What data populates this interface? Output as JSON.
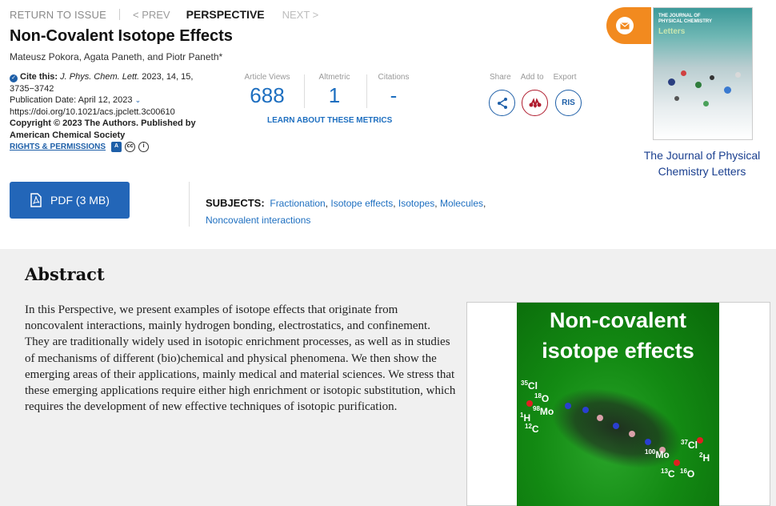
{
  "nav": {
    "return": "RETURN TO ISSUE",
    "prev": "< PREV",
    "current": "PERSPECTIVE",
    "next": "NEXT >"
  },
  "article": {
    "title": "Non-Covalent Isotope Effects",
    "authors": "Mateusz Pokora, Agata Paneth, and Piotr Paneth*",
    "cite_label": "Cite this:",
    "cite_journal": "J. Phys. Chem. Lett.",
    "cite_details": "2023, 14, 15, 3735−3742",
    "pub_date": "Publication Date: April 12, 2023",
    "doi": "https://doi.org/10.1021/acs.jpclett.3c00610",
    "copyright": "Copyright © 2023 The Authors. Published by American Chemical Society",
    "rights": "RIGHTS & PERMISSIONS"
  },
  "metrics": {
    "views_label": "Article Views",
    "views": "688",
    "altmetric_label": "Altmetric",
    "altmetric": "1",
    "citations_label": "Citations",
    "citations": "-",
    "learn": "LEARN ABOUT THESE METRICS"
  },
  "actions": {
    "share": "Share",
    "add_to": "Add to",
    "export": "Export",
    "ris": "RIS"
  },
  "journal": {
    "name": "The Journal of Physical Chemistry Letters",
    "cover_title_1": "THE JOURNAL OF",
    "cover_title_2": "PHYSICAL CHEMISTRY",
    "cover_title_3": "Letters"
  },
  "pdf": {
    "label": "PDF (3 MB)"
  },
  "subjects": {
    "heading": "SUBJECTS:",
    "items": [
      "Fractionation",
      "Isotope effects",
      "Isotopes",
      "Molecules",
      "Noncovalent interactions"
    ]
  },
  "abstract": {
    "heading": "Abstract",
    "text": "In this Perspective, we present examples of isotope effects that originate from noncovalent interactions, mainly hydrogen bonding, electrostatics, and confinement. They are traditionally widely used in isotopic enrichment processes, as well as in studies of mechanisms of different (bio)chemical and physical phenomena. We then show the emerging areas of their applications, mainly medical and material sciences. We stress that these emerging applications require either high enrichment or isotopic substitution, which requires the development of new effective techniques of isotopic purification."
  },
  "toc_graphic": {
    "line1": "Non-covalent",
    "line2": "isotope effects",
    "labels": [
      "35Cl",
      "18O",
      "98Mo",
      "1H",
      "12C",
      "100Mo",
      "37Cl",
      "2H",
      "13C",
      "16O"
    ]
  },
  "colors": {
    "accent": "#1e6fc0",
    "pdf_button": "#2366b8",
    "badge": "#f28a1f",
    "abstract_bg": "#f0f0f0"
  }
}
